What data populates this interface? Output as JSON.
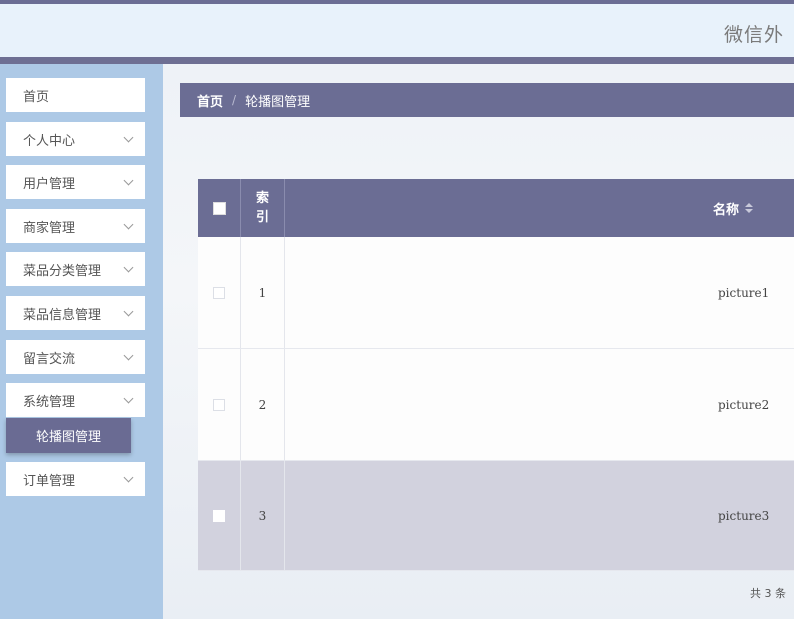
{
  "header": {
    "title": "微信外"
  },
  "sidebar": {
    "items": [
      {
        "label": "首页",
        "has_children": false
      },
      {
        "label": "个人中心",
        "has_children": true
      },
      {
        "label": "用户管理",
        "has_children": true
      },
      {
        "label": "商家管理",
        "has_children": true
      },
      {
        "label": "菜品分类管理",
        "has_children": true
      },
      {
        "label": "菜品信息管理",
        "has_children": true
      },
      {
        "label": "留言交流",
        "has_children": true
      },
      {
        "label": "系统管理",
        "has_children": true
      },
      {
        "label": "订单管理",
        "has_children": true
      }
    ],
    "active_submenu": "轮播图管理"
  },
  "breadcrumb": {
    "home": "首页",
    "separator": "/",
    "current": "轮播图管理"
  },
  "table": {
    "headers": {
      "index": "索\n引",
      "name": "名称"
    },
    "rows": [
      {
        "index": "1",
        "name": "picture1"
      },
      {
        "index": "2",
        "name": "picture2"
      },
      {
        "index": "3",
        "name": "picture3"
      }
    ]
  },
  "pagination": {
    "total_text": "共 3 条"
  },
  "colors": {
    "accent": "#6b6d94",
    "sidebar_bg": "#adc9e6",
    "header_bg": "#e8f2fb"
  }
}
